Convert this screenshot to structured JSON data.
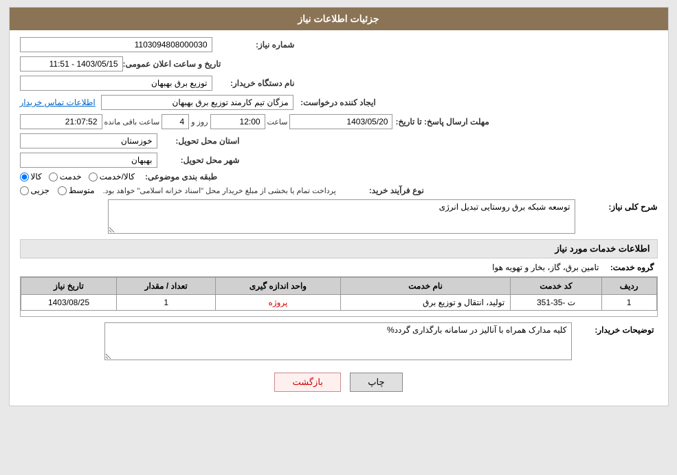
{
  "header": {
    "title": "جزئیات اطلاعات نیاز"
  },
  "form": {
    "need_number_label": "شماره نیاز:",
    "need_number_value": "1103094808000030",
    "announcement_date_label": "تاریخ و ساعت اعلان عمومی:",
    "announcement_date_value": "1403/05/15 - 11:51",
    "buyer_org_label": "نام دستگاه خریدار:",
    "buyer_org_value": "توزیع برق بهبهان",
    "creator_label": "ایجاد کننده درخواست:",
    "creator_value": "مزگان تیم کارمند توزیع برق بهبهان",
    "contact_link": "اطلاعات تماس خریدار",
    "deadline_label": "مهلت ارسال پاسخ: تا تاریخ:",
    "deadline_date": "1403/05/20",
    "deadline_time_label": "ساعت",
    "deadline_time": "12:00",
    "deadline_days_label": "روز و",
    "deadline_days": "4",
    "deadline_remaining_label": "ساعت باقی مانده",
    "deadline_remaining": "21:07:52",
    "province_label": "استان محل تحویل:",
    "province_value": "خوزستان",
    "city_label": "شهر محل تحویل:",
    "city_value": "بهبهان",
    "category_label": "طبقه بندی موضوعی:",
    "category_options": [
      "کالا",
      "خدمت",
      "کالا/خدمت"
    ],
    "category_selected": "کالا",
    "purchase_type_label": "نوع فرآیند خرید:",
    "purchase_type_options": [
      "جزیی",
      "متوسط"
    ],
    "purchase_type_note": "پرداخت تمام یا بخشی از مبلغ خریدار محل \"اسناد خزانه اسلامی\" خواهد بود.",
    "description_label": "شرح کلی نیاز:",
    "description_value": "توسعه شبکه برق روستایی تبدیل انرژی",
    "services_section_title": "اطلاعات خدمات مورد نیاز",
    "service_group_label": "گروه خدمت:",
    "service_group_value": "تامین برق، گاز، بخار و تهویه هوا",
    "table": {
      "headers": [
        "ردیف",
        "کد خدمت",
        "نام خدمت",
        "واحد اندازه گیری",
        "تعداد / مقدار",
        "تاریخ نیاز"
      ],
      "rows": [
        {
          "row": "1",
          "code": "ت -35-351",
          "name": "تولید، انتقال و توزیع برق",
          "unit": "پروژه",
          "quantity": "1",
          "date": "1403/08/25"
        }
      ]
    },
    "buyer_notes_label": "توضیحات خریدار:",
    "buyer_notes_value": "کلیه مدارک همراه با آنالیز در سامانه بارگذاری گردد%"
  },
  "buttons": {
    "print": "چاپ",
    "back": "بازگشت"
  }
}
